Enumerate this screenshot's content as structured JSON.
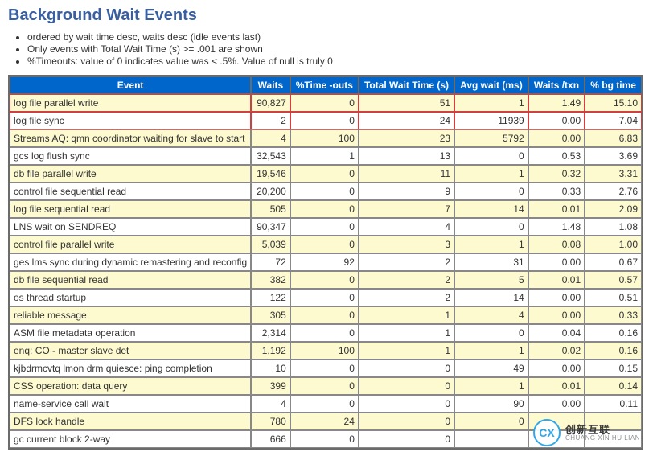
{
  "title": "Background Wait Events",
  "notes": [
    "ordered by wait time desc, waits desc (idle events last)",
    "Only events with Total Wait Time (s) >= .001 are shown",
    "%Timeouts: value of 0 indicates value was < .5%. Value of null is truly 0"
  ],
  "columns": [
    "Event",
    "Waits",
    "%Time -outs",
    "Total Wait Time (s)",
    "Avg wait (ms)",
    "Waits /txn",
    "% bg time"
  ],
  "rows": [
    {
      "hl": true,
      "event": "log file parallel write",
      "waits": "90,827",
      "timeouts": "0",
      "total_wait": "51",
      "avg_wait": "1",
      "waits_txn": "1.49",
      "bg_time": "15.10"
    },
    {
      "hl": true,
      "event": "log file sync",
      "waits": "2",
      "timeouts": "0",
      "total_wait": "24",
      "avg_wait": "11939",
      "waits_txn": "0.00",
      "bg_time": "7.04"
    },
    {
      "hl": false,
      "event": "Streams AQ: qmn coordinator waiting for slave to start",
      "waits": "4",
      "timeouts": "100",
      "total_wait": "23",
      "avg_wait": "5792",
      "waits_txn": "0.00",
      "bg_time": "6.83"
    },
    {
      "hl": false,
      "event": "gcs log flush sync",
      "waits": "32,543",
      "timeouts": "1",
      "total_wait": "13",
      "avg_wait": "0",
      "waits_txn": "0.53",
      "bg_time": "3.69"
    },
    {
      "hl": false,
      "event": "db file parallel write",
      "waits": "19,546",
      "timeouts": "0",
      "total_wait": "11",
      "avg_wait": "1",
      "waits_txn": "0.32",
      "bg_time": "3.31"
    },
    {
      "hl": false,
      "event": "control file sequential read",
      "waits": "20,200",
      "timeouts": "0",
      "total_wait": "9",
      "avg_wait": "0",
      "waits_txn": "0.33",
      "bg_time": "2.76"
    },
    {
      "hl": false,
      "event": "log file sequential read",
      "waits": "505",
      "timeouts": "0",
      "total_wait": "7",
      "avg_wait": "14",
      "waits_txn": "0.01",
      "bg_time": "2.09"
    },
    {
      "hl": false,
      "event": "LNS wait on SENDREQ",
      "waits": "90,347",
      "timeouts": "0",
      "total_wait": "4",
      "avg_wait": "0",
      "waits_txn": "1.48",
      "bg_time": "1.08"
    },
    {
      "hl": false,
      "event": "control file parallel write",
      "waits": "5,039",
      "timeouts": "0",
      "total_wait": "3",
      "avg_wait": "1",
      "waits_txn": "0.08",
      "bg_time": "1.00"
    },
    {
      "hl": false,
      "event": "ges lms sync during dynamic remastering and reconfig",
      "waits": "72",
      "timeouts": "92",
      "total_wait": "2",
      "avg_wait": "31",
      "waits_txn": "0.00",
      "bg_time": "0.67"
    },
    {
      "hl": false,
      "event": "db file sequential read",
      "waits": "382",
      "timeouts": "0",
      "total_wait": "2",
      "avg_wait": "5",
      "waits_txn": "0.01",
      "bg_time": "0.57"
    },
    {
      "hl": false,
      "event": "os thread startup",
      "waits": "122",
      "timeouts": "0",
      "total_wait": "2",
      "avg_wait": "14",
      "waits_txn": "0.00",
      "bg_time": "0.51"
    },
    {
      "hl": false,
      "event": "reliable message",
      "waits": "305",
      "timeouts": "0",
      "total_wait": "1",
      "avg_wait": "4",
      "waits_txn": "0.00",
      "bg_time": "0.33"
    },
    {
      "hl": false,
      "event": "ASM file metadata operation",
      "waits": "2,314",
      "timeouts": "0",
      "total_wait": "1",
      "avg_wait": "0",
      "waits_txn": "0.04",
      "bg_time": "0.16"
    },
    {
      "hl": false,
      "event": "enq: CO - master slave det",
      "waits": "1,192",
      "timeouts": "100",
      "total_wait": "1",
      "avg_wait": "1",
      "waits_txn": "0.02",
      "bg_time": "0.16"
    },
    {
      "hl": false,
      "event": "kjbdrmcvtq lmon drm quiesce: ping completion",
      "waits": "10",
      "timeouts": "0",
      "total_wait": "0",
      "avg_wait": "49",
      "waits_txn": "0.00",
      "bg_time": "0.15"
    },
    {
      "hl": false,
      "event": "CSS operation: data query",
      "waits": "399",
      "timeouts": "0",
      "total_wait": "0",
      "avg_wait": "1",
      "waits_txn": "0.01",
      "bg_time": "0.14"
    },
    {
      "hl": false,
      "event": "name-service call wait",
      "waits": "4",
      "timeouts": "0",
      "total_wait": "0",
      "avg_wait": "90",
      "waits_txn": "0.00",
      "bg_time": "0.11"
    },
    {
      "hl": false,
      "event": "DFS lock handle",
      "waits": "780",
      "timeouts": "24",
      "total_wait": "0",
      "avg_wait": "0",
      "waits_txn": "",
      "bg_time": ""
    },
    {
      "hl": false,
      "event": "gc current block 2-way",
      "waits": "666",
      "timeouts": "0",
      "total_wait": "0",
      "avg_wait": "",
      "waits_txn": "",
      "bg_time": ""
    }
  ],
  "watermark": {
    "logo_text": "CX",
    "cn": "创新互联",
    "py": "CHUANG XIN HU LIAN"
  }
}
